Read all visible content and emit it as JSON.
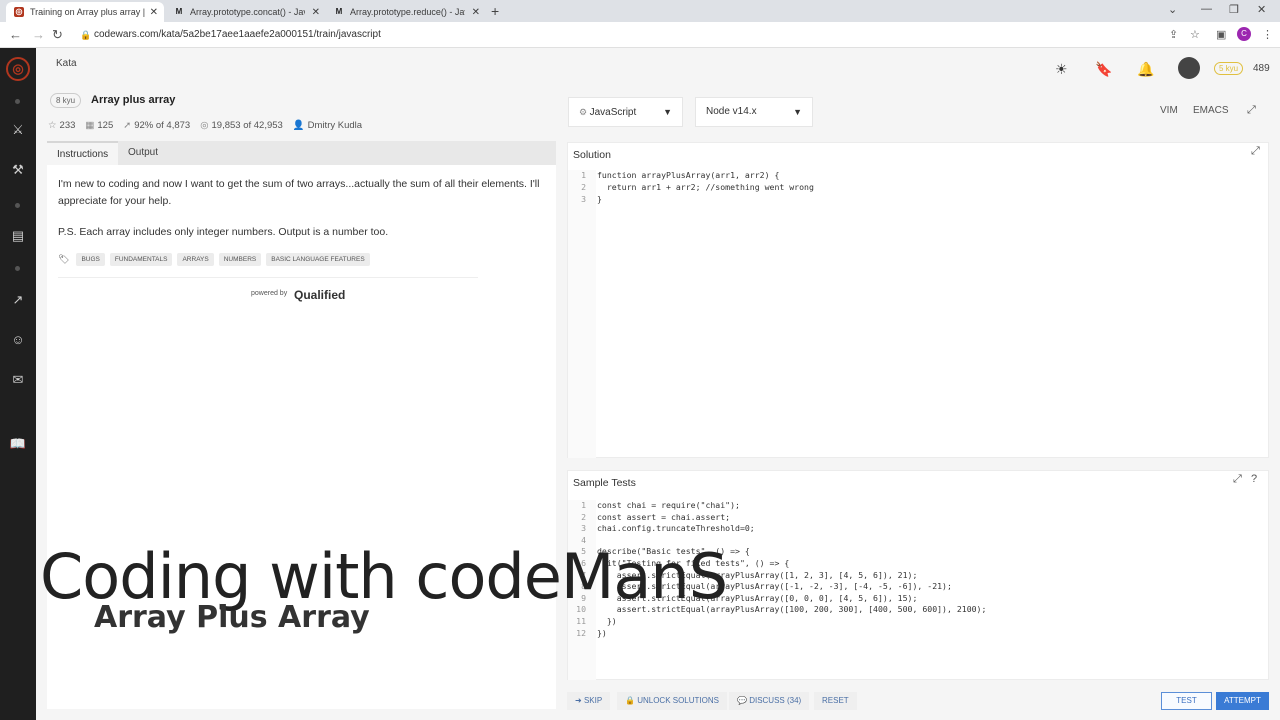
{
  "browser": {
    "tabs": [
      {
        "title": "Training on Array plus array | Co",
        "active": true
      },
      {
        "title": "Array.prototype.concat() - JavaSc",
        "active": false
      },
      {
        "title": "Array.prototype.reduce() - JavaSc",
        "active": false
      }
    ],
    "url": "codewars.com/kata/5a2be17aee1aaefe2a000151/train/javascript",
    "profile_initial": "C"
  },
  "header": {
    "section": "Kata",
    "rank_badge": "5 kyu",
    "honor": "489"
  },
  "kata": {
    "kyu": "8 kyu",
    "title": "Array plus array",
    "stats": {
      "stars": "233",
      "bookmarks": "125",
      "satisfaction": "92%",
      "satisfaction_of": "of 4,873",
      "completed": "19,853",
      "completed_of": "of 42,953",
      "author": "Dmitry Kudla"
    }
  },
  "instructions": {
    "tabs": [
      "Instructions",
      "Output"
    ],
    "paragraphs": [
      "I'm new to coding and now I want to get the sum of two arrays...actually the sum of all their elements. I'll appreciate for your help.",
      "P.S. Each array includes only integer numbers. Output is a number too."
    ],
    "tags": [
      "BUGS",
      "FUNDAMENTALS",
      "ARRAYS",
      "NUMBERS",
      "BASIC LANGUAGE FEATURES"
    ],
    "powered_by": "powered by",
    "qualified": "Qualified"
  },
  "runtime": {
    "language": "JavaScript",
    "version": "Node v14.x",
    "modes": [
      "VIM",
      "EMACS"
    ]
  },
  "solution": {
    "title": "Solution",
    "lines": [
      "function arrayPlusArray(arr1, arr2) {",
      "  return arr1 + arr2; //something went wrong",
      "}"
    ]
  },
  "tests": {
    "title": "Sample Tests",
    "lines": [
      "const chai = require(\"chai\");",
      "const assert = chai.assert;",
      "chai.config.truncateThreshold=0;",
      "",
      "describe(\"Basic tests\", () => {",
      "  it(\"Testing for fixed tests\", () => {",
      "    assert.strictEqual(arrayPlusArray([1, 2, 3], [4, 5, 6]), 21);",
      "    assert.strictEqual(arrayPlusArray([-1, -2, -3], [-4, -5, -6]), -21);",
      "    assert.strictEqual(arrayPlusArray([0, 0, 0], [4, 5, 6]), 15);",
      "    assert.strictEqual(arrayPlusArray([100, 200, 300], [400, 500, 600]), 2100);",
      "  })",
      "})"
    ]
  },
  "actions": {
    "skip": "SKIP",
    "unlock": "UNLOCK SOLUTIONS",
    "discuss": "DISCUSS (34)",
    "reset": "RESET",
    "test": "TEST",
    "attempt": "ATTEMPT"
  },
  "overlay": {
    "title": "Coding with codeManS",
    "subtitle": "Array Plus Array"
  }
}
